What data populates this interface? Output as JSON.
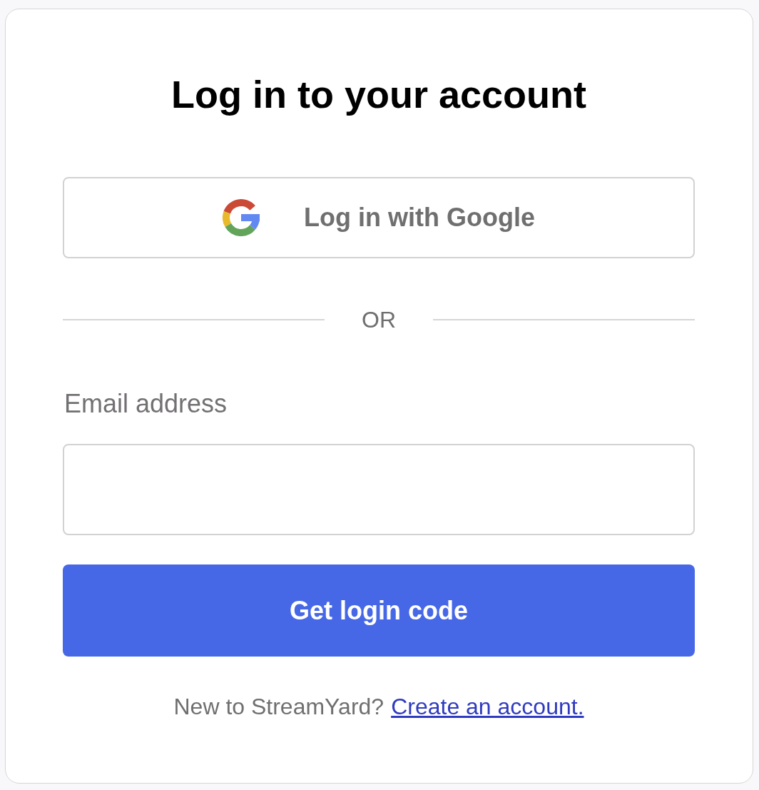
{
  "title": "Log in to your account",
  "google_button": {
    "label": "Log in with Google"
  },
  "divider": {
    "label": "OR"
  },
  "email_field": {
    "label": "Email address"
  },
  "submit_button": {
    "label": "Get login code"
  },
  "footer": {
    "prompt": "New to StreamYard?",
    "link": "Create an account."
  }
}
